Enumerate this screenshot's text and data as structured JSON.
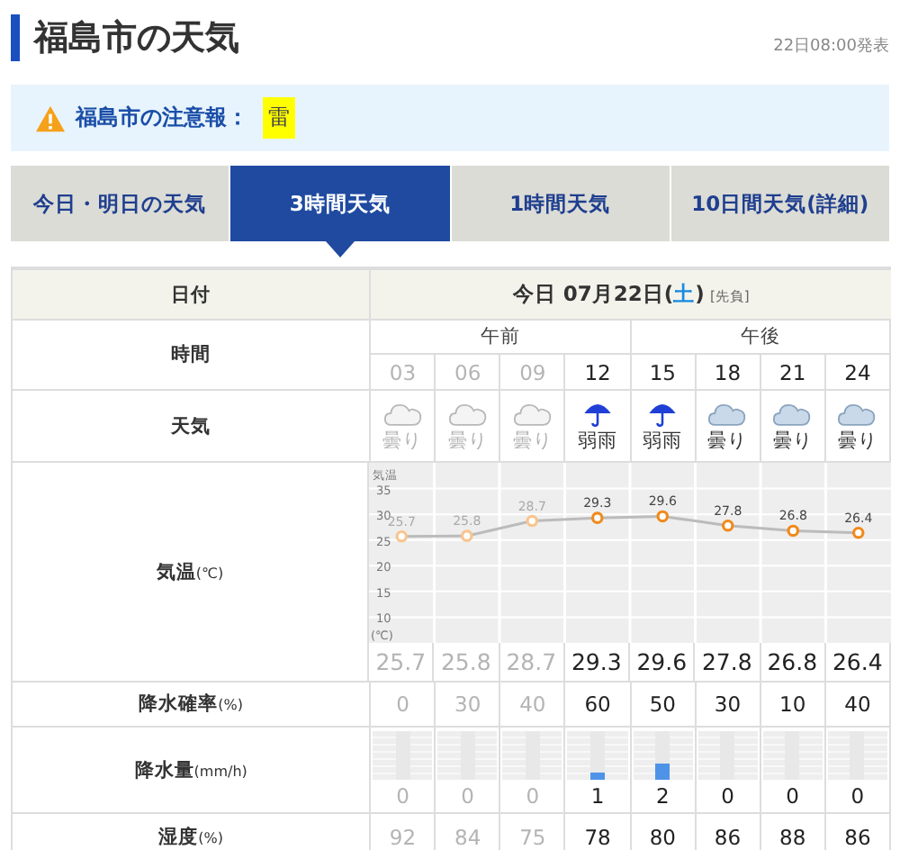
{
  "header": {
    "title": "福島市の天気",
    "issued": "22日08:00発表"
  },
  "alert": {
    "label": "福島市の注意報：",
    "warnings": [
      "雷"
    ]
  },
  "tabs": [
    {
      "label": "今日・明日の天気",
      "selected": false
    },
    {
      "label": "3時間天気",
      "selected": true
    },
    {
      "label": "1時間天気",
      "selected": false
    },
    {
      "label": "10日間天気(詳細)",
      "selected": false
    }
  ],
  "table": {
    "date_label": "日付",
    "date_parts": [
      {
        "text": "今日 07月22日(",
        "kind": "plain"
      },
      {
        "text": "土",
        "kind": "weekday"
      },
      {
        "text": ")",
        "kind": "plain"
      },
      {
        "text": "[先負]",
        "kind": "note"
      }
    ],
    "time_label": "時間",
    "weather_label": "天気",
    "temp_label": {
      "label": "気温",
      "unit": "(℃)"
    },
    "pop_label": {
      "label": "降水確率",
      "unit": "(%)"
    },
    "precip_label": {
      "label": "降水量",
      "unit": "(mm/h)"
    },
    "humidity_label": {
      "label": "湿度",
      "unit": "(%)"
    },
    "periods": [
      {
        "label": "午前",
        "hours": [
          {
            "hour": "03",
            "past": true,
            "kind": "cloud",
            "weather": "曇り",
            "temp": "25.7",
            "pop": "0",
            "precip": "0",
            "humidity": "92"
          },
          {
            "hour": "06",
            "past": true,
            "kind": "cloud",
            "weather": "曇り",
            "temp": "25.8",
            "pop": "30",
            "precip": "0",
            "humidity": "84"
          },
          {
            "hour": "09",
            "past": true,
            "kind": "cloud",
            "weather": "曇り",
            "temp": "28.7",
            "pop": "40",
            "precip": "0",
            "humidity": "75"
          },
          {
            "hour": "12",
            "past": false,
            "kind": "rain",
            "weather": "弱雨",
            "temp": "29.3",
            "pop": "60",
            "precip": "1",
            "level": 0.15,
            "humidity": "78"
          }
        ]
      },
      {
        "label": "午後",
        "hours": [
          {
            "hour": "15",
            "past": false,
            "kind": "rain",
            "weather": "弱雨",
            "temp": "29.6",
            "pop": "50",
            "precip": "2",
            "level": 0.35,
            "humidity": "80"
          },
          {
            "hour": "18",
            "past": false,
            "kind": "cloud",
            "weather": "曇り",
            "temp": "27.8",
            "pop": "30",
            "precip": "0",
            "humidity": "86"
          },
          {
            "hour": "21",
            "past": false,
            "kind": "cloud",
            "weather": "曇り",
            "temp": "26.8",
            "pop": "10",
            "precip": "0",
            "humidity": "88"
          },
          {
            "hour": "24",
            "past": false,
            "kind": "cloud",
            "weather": "曇り",
            "temp": "26.4",
            "pop": "40",
            "precip": "0",
            "humidity": "86"
          }
        ]
      }
    ],
    "chart_unit": "(℃)",
    "chart_data": {
      "type": "line",
      "ylim": [
        5,
        40
      ],
      "yticks": [
        10,
        15,
        20,
        25,
        30,
        35
      ],
      "grid": true,
      "value_labels": [
        "25.7",
        "25.8",
        "28.7",
        "29.3",
        "29.6",
        "27.8",
        "26.8",
        "26.4"
      ],
      "series": [
        {
          "name": "気温",
          "color": "#bbbbbb",
          "marker": {
            "color": "#f08a1c"
          },
          "values": [
            25.7,
            25.8,
            28.7,
            29.3,
            29.6,
            27.8,
            26.8,
            26.4
          ]
        }
      ]
    }
  }
}
